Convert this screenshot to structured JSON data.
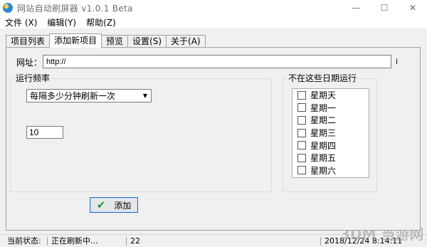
{
  "window": {
    "title": "网站自动刷屏器 v1.0.1 Beta",
    "minimize": "—",
    "maximize": "☐",
    "close": "✕"
  },
  "menu": [
    {
      "label": "文件 (X)"
    },
    {
      "label": "编辑(Y)"
    },
    {
      "label": "帮助(Z)"
    }
  ],
  "tabs": [
    {
      "label": "项目列表",
      "active": false
    },
    {
      "label": "添加新项目",
      "active": true
    },
    {
      "label": "预览",
      "active": false
    },
    {
      "label": "设置(S)",
      "active": false
    },
    {
      "label": "关于(A)",
      "active": false
    }
  ],
  "url": {
    "label": "网址：",
    "value": "http://",
    "info": "i"
  },
  "frequency": {
    "group_label": "运行频率",
    "selected": "每隔多少分钟刷新一次",
    "interval_value": "10"
  },
  "days": {
    "group_label": "不在这些日期运行",
    "items": [
      {
        "label": "星期天",
        "checked": false
      },
      {
        "label": "星期一",
        "checked": false
      },
      {
        "label": "星期二",
        "checked": false
      },
      {
        "label": "星期三",
        "checked": false
      },
      {
        "label": "星期四",
        "checked": false
      },
      {
        "label": "星期五",
        "checked": false
      },
      {
        "label": "星期六",
        "checked": false
      }
    ]
  },
  "add_button": {
    "label": "添加",
    "icon": "check-icon"
  },
  "status": {
    "label": "当前状态:",
    "state": "正在刷新中...",
    "count": "22",
    "datetime": "2018/12/24 8:14:11"
  },
  "watermark": {
    "text": "3DM 当游网"
  }
}
